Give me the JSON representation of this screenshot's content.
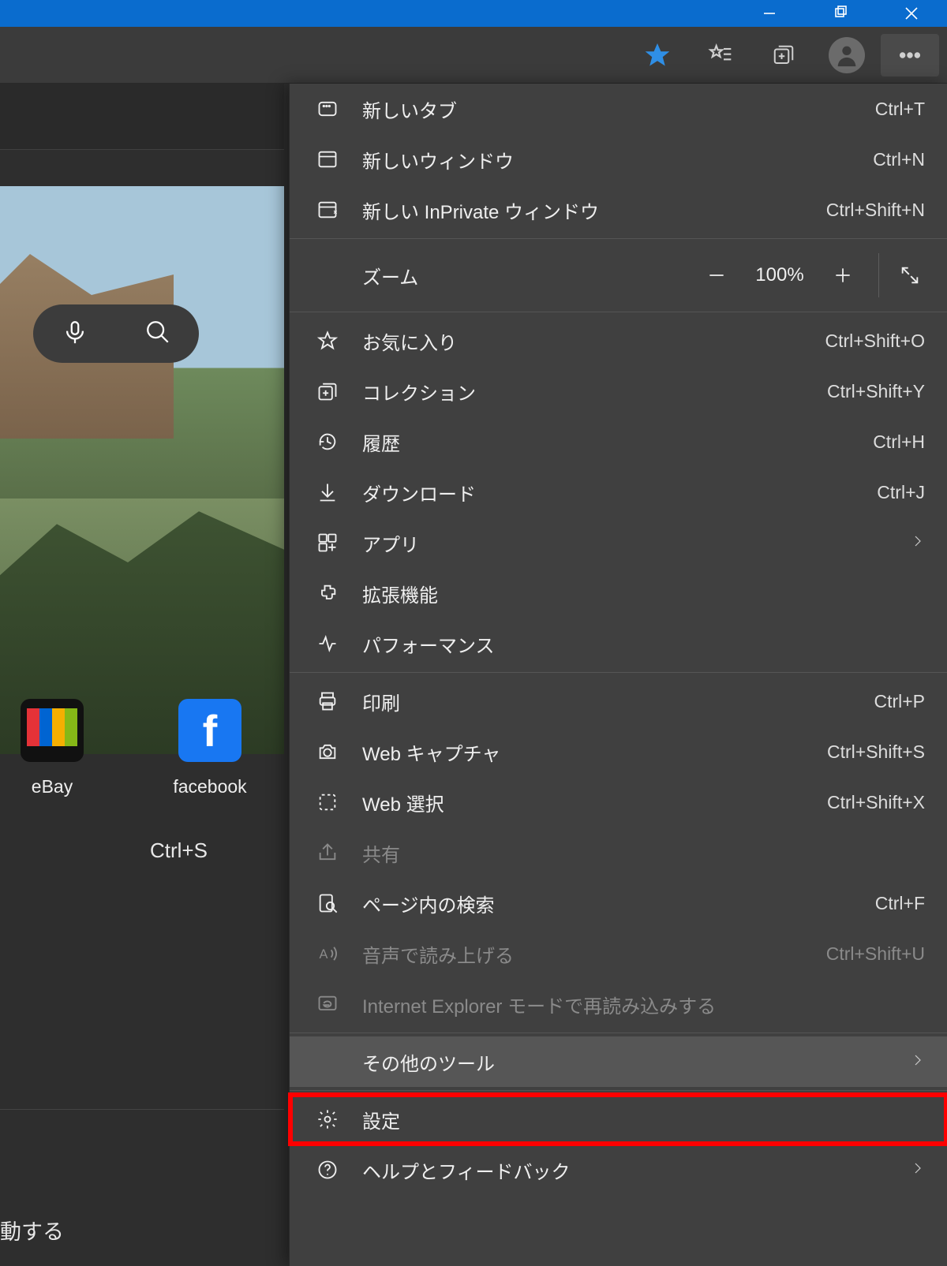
{
  "toolbar": {
    "star_active": true
  },
  "tiles": [
    {
      "label": "eBay"
    },
    {
      "label": "facebook"
    }
  ],
  "bleed": {
    "ctrl_s": "Ctrl+S",
    "boot_text": "動する"
  },
  "zoom": {
    "label": "ズーム",
    "value": "100%"
  },
  "menu": {
    "new_tab": {
      "label": "新しいタブ",
      "shortcut": "Ctrl+T"
    },
    "new_window": {
      "label": "新しいウィンドウ",
      "shortcut": "Ctrl+N"
    },
    "new_inprivate": {
      "label": "新しい InPrivate ウィンドウ",
      "shortcut": "Ctrl+Shift+N"
    },
    "favorites": {
      "label": "お気に入り",
      "shortcut": "Ctrl+Shift+O"
    },
    "collections": {
      "label": "コレクション",
      "shortcut": "Ctrl+Shift+Y"
    },
    "history": {
      "label": "履歴",
      "shortcut": "Ctrl+H"
    },
    "downloads": {
      "label": "ダウンロード",
      "shortcut": "Ctrl+J"
    },
    "apps": {
      "label": "アプリ"
    },
    "extensions": {
      "label": "拡張機能"
    },
    "performance": {
      "label": "パフォーマンス"
    },
    "print": {
      "label": "印刷",
      "shortcut": "Ctrl+P"
    },
    "web_capture": {
      "label": "Web キャプチャ",
      "shortcut": "Ctrl+Shift+S"
    },
    "web_select": {
      "label": "Web 選択",
      "shortcut": "Ctrl+Shift+X"
    },
    "share": {
      "label": "共有"
    },
    "find": {
      "label": "ページ内の検索",
      "shortcut": "Ctrl+F"
    },
    "read_aloud": {
      "label": "音声で読み上げる",
      "shortcut": "Ctrl+Shift+U"
    },
    "ie_mode": {
      "label": "Internet Explorer モードで再読み込みする"
    },
    "more_tools": {
      "label": "その他のツール"
    },
    "settings": {
      "label": "設定"
    },
    "help": {
      "label": "ヘルプとフィードバック"
    }
  }
}
